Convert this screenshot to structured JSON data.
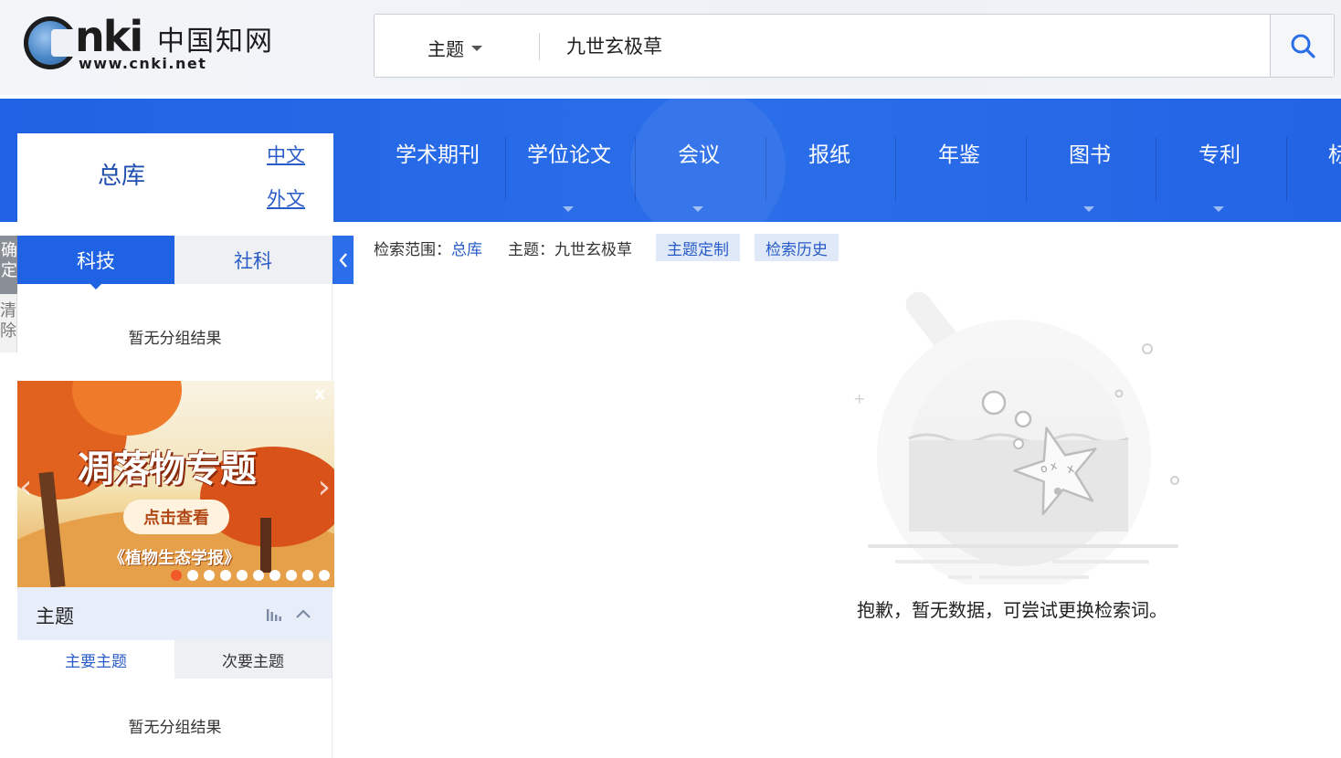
{
  "logo": {
    "brand": "nki",
    "chinese": "中国知网",
    "url": "www.cnki.net"
  },
  "search": {
    "type": "主题",
    "query": "九世玄极草"
  },
  "nav": {
    "items": [
      {
        "label": "学术期刊",
        "dropdown": false
      },
      {
        "label": "学位论文",
        "dropdown": true
      },
      {
        "label": "会议",
        "dropdown": true
      },
      {
        "label": "报纸",
        "dropdown": false
      },
      {
        "label": "年鉴",
        "dropdown": false
      },
      {
        "label": "图书",
        "dropdown": true
      },
      {
        "label": "专利",
        "dropdown": true
      },
      {
        "label": "标",
        "dropdown": false
      }
    ]
  },
  "db": {
    "total": "总库",
    "zh": "中文",
    "foreign": "外文"
  },
  "edge": {
    "confirm": "确定",
    "clear": "清除"
  },
  "categories": {
    "active": "科技",
    "inactive": "社科"
  },
  "left": {
    "no_group_1": "暂无分组结果",
    "no_group_2": "暂无分组结果",
    "topic_title": "主题",
    "subtab_main": "主要主题",
    "subtab_secondary": "次要主题"
  },
  "banner": {
    "title": "凋落物专题",
    "button": "点击查看",
    "journal": "《植物生态学报》",
    "close": "x",
    "dots_total": 10,
    "dots_active": 0
  },
  "scope": {
    "label": "检索范围：",
    "value": "总库",
    "topic": "主题：九世玄极草",
    "btn_custom": "主题定制",
    "btn_history": "检索历史"
  },
  "empty": {
    "message": "抱歉，暂无数据，可尝试更换检索词。"
  },
  "colors": {
    "nav_blue": "#1f63e4",
    "link_blue": "#2a5cc8",
    "accent_orange": "#f1592a"
  }
}
